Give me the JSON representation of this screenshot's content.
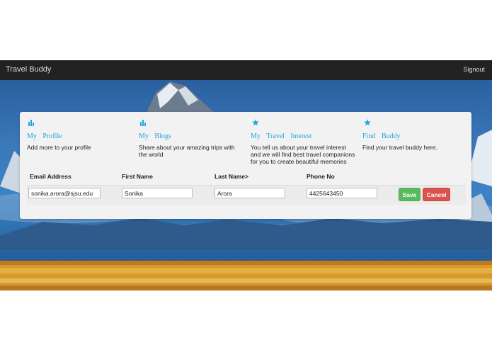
{
  "navbar": {
    "brand": "Travel Buddy",
    "signout_label": "Signout"
  },
  "features": [
    {
      "icon": "bar-chart-icon",
      "title": "My Profile",
      "description": "Add more to your profile"
    },
    {
      "icon": "bar-chart-icon",
      "title": "My Blogs",
      "description": "Share about your amazing trips with the world"
    },
    {
      "icon": "star-icon",
      "title": "My Travel Interest",
      "description": "You tell us about your travel interest and we will find best travel companions for you to create beautiful memories"
    },
    {
      "icon": "star-icon",
      "title": "Find Buddy",
      "description": "Find your travel buddy here."
    }
  ],
  "profile_table": {
    "headers": {
      "email": "Email Address",
      "first_name": "First Name",
      "last_name": "Last Name>",
      "phone": "Phone No"
    },
    "row": {
      "email": "sonika.arora@sjsu.edu",
      "first_name": "Sonika",
      "last_name": "Arora",
      "phone": "4425643450"
    },
    "save_label": "Save",
    "cancel_label": "Cancel"
  },
  "colors": {
    "navbar": "#222222",
    "accent": "#1ea5e0",
    "save": "#5cb85c",
    "cancel": "#d9534f"
  }
}
